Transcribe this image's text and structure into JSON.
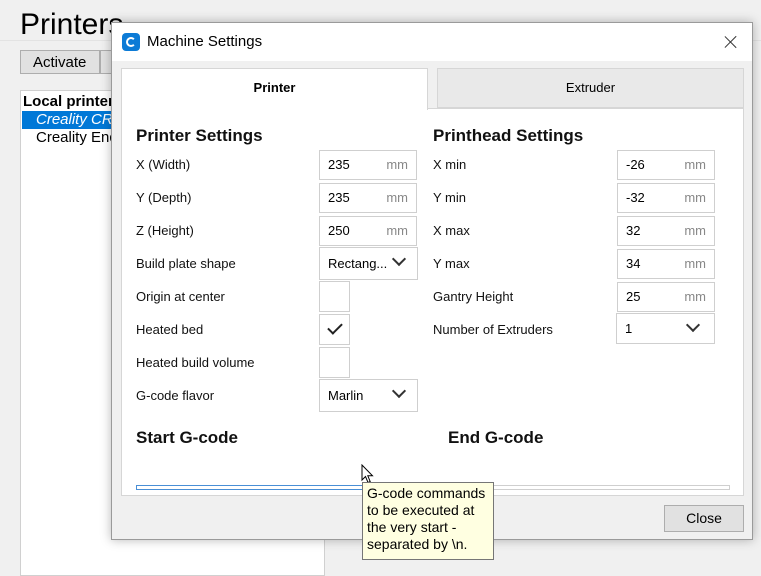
{
  "background": {
    "title": "Printers",
    "activate_label": "Activate",
    "list_header": "Local printers",
    "list_selected": "Creality CR-",
    "list_item2": "Creality End"
  },
  "dialog": {
    "title": "Machine Settings",
    "close_label": "Close",
    "tabs": [
      {
        "label": "Printer",
        "active": true
      },
      {
        "label": "Extruder",
        "active": false
      }
    ]
  },
  "printer_settings": {
    "title": "Printer Settings",
    "x_width": {
      "label": "X (Width)",
      "value": "235",
      "unit": "mm"
    },
    "y_depth": {
      "label": "Y (Depth)",
      "value": "235",
      "unit": "mm"
    },
    "z_height": {
      "label": "Z (Height)",
      "value": "250",
      "unit": "mm"
    },
    "build_plate_shape": {
      "label": "Build plate shape",
      "value": "Rectang..."
    },
    "origin_at_center": {
      "label": "Origin at center",
      "checked": false
    },
    "heated_bed": {
      "label": "Heated bed",
      "checked": true
    },
    "heated_build_volume": {
      "label": "Heated build volume",
      "checked": false
    },
    "gcode_flavor": {
      "label": "G-code flavor",
      "value": "Marlin"
    }
  },
  "printhead_settings": {
    "title": "Printhead Settings",
    "x_min": {
      "label": "X min",
      "value": "-26",
      "unit": "mm"
    },
    "y_min": {
      "label": "Y min",
      "value": "-32",
      "unit": "mm"
    },
    "x_max": {
      "label": "X max",
      "value": "32",
      "unit": "mm"
    },
    "y_max": {
      "label": "Y max",
      "value": "34",
      "unit": "mm"
    },
    "gantry_height": {
      "label": "Gantry Height",
      "value": "25",
      "unit": "mm"
    },
    "num_extruders": {
      "label": "Number of Extruders",
      "value": "1"
    }
  },
  "gcode": {
    "start_title": "Start G-code",
    "end_title": "End G-code"
  },
  "tooltip": {
    "text": "G-code commands to be executed at the very start - separated by \\n."
  },
  "colors": {
    "accent": "#0078d7",
    "start_gcode_border": "#4a8fd6",
    "tooltip_bg": "#ffffe1"
  }
}
